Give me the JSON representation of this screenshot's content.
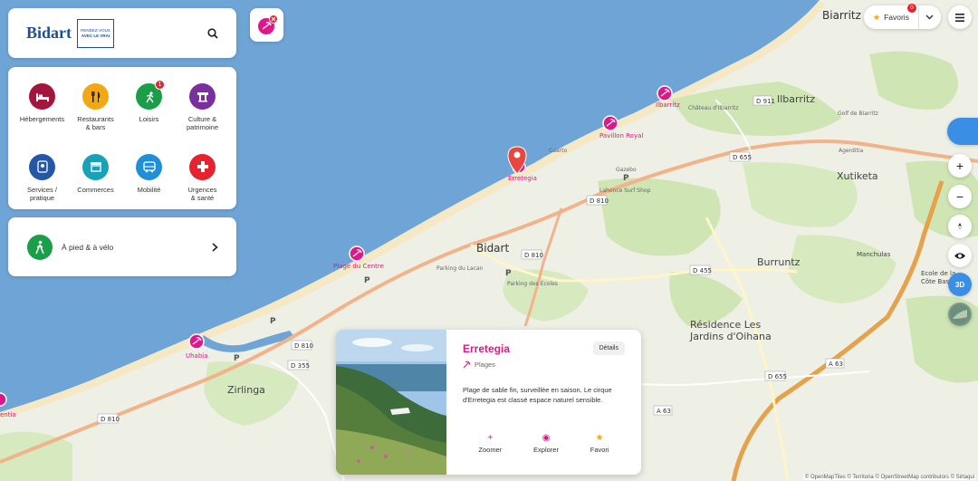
{
  "brand": {
    "name": "Bidart",
    "slogan_line1": "RENDEZ-VOUS",
    "slogan_line2": "AVEC LE VRAI"
  },
  "categories": [
    {
      "label": "Hébergements",
      "color": "#a3173f",
      "icon": "bed-icon"
    },
    {
      "label": "Restaurants\n& bars",
      "color": "#f3a712",
      "icon": "restaurant-icon"
    },
    {
      "label": "Loisirs",
      "color": "#1a9e47",
      "icon": "activity-icon",
      "badge": "1"
    },
    {
      "label": "Culture &\npatrimoine",
      "color": "#7b2f9e",
      "icon": "monument-icon"
    },
    {
      "label": "Services /\npratique",
      "color": "#2458a6",
      "icon": "info-icon"
    },
    {
      "label": "Commerces",
      "color": "#17a2b8",
      "icon": "shop-icon"
    },
    {
      "label": "Mobilité",
      "color": "#1f8fd6",
      "icon": "bus-icon"
    },
    {
      "label": "Urgences\n& santé",
      "color": "#e4232e",
      "icon": "cross-icon"
    }
  ],
  "walk": {
    "label": "À pied & à vélo"
  },
  "favorites": {
    "label": "Favoris",
    "count": "0"
  },
  "map_controls": {
    "three_d": "3D"
  },
  "map_labels": {
    "biarritz": "Biarritz",
    "ilbarritz": "Ilbarritz",
    "bidart": "Bidart",
    "burruntz": "Burruntz",
    "xutiketa": "Xutiketa",
    "zirlinga": "Zirlinga",
    "residence_line1": "Résidence Les",
    "residence_line2": "Jardins d'Oihana",
    "manchulas": "Manchulas",
    "ecole_line1": "Ecole de la",
    "ecole_line2": "Côte Basq",
    "chateau": "Château d'Ilbarritz",
    "parking_lacan": "Parking du Lacan",
    "parking_ecoles": "Parking des Ecoles",
    "golf": "Golf de Biarritz",
    "gazebo": "Gazebo",
    "surf_shop": "Lahonce Surf Shop",
    "agerditia": "Agerditia",
    "beach_erretegia": "Erretegia",
    "beach_centre": "Plage du Centre",
    "beach_uhabia": "Uhabia",
    "beach_ilbarritz": "Ilbarritz",
    "beach_pavillon": "Pavillon Royal",
    "beach_cuarto": "Cuarto",
    "beach_ententia": "entia"
  },
  "roads": [
    "D 810",
    "D 810",
    "D 810",
    "D 810",
    "D 655",
    "D 655",
    "D 455",
    "D 355",
    "D 911",
    "A 63",
    "A 63"
  ],
  "card": {
    "title": "Erretegia",
    "details_label": "Détails",
    "category": "Plages",
    "description": "Plage de sable fin, surveillée en saison. Le cirque d'Erretegia est classé espace naturel sensible.",
    "actions": {
      "zoom": "Zoomer",
      "explore": "Explorer",
      "favorite": "Favori"
    }
  },
  "attribution": "© OpenMapTiles © Territoria © OpenStreetMap contributors © Sirtaqui",
  "colors": {
    "sea": "#6ea4d6",
    "land": "#eef0e6",
    "green": "#cfe5b4",
    "beach": "#e0178a",
    "accent": "#3a8ee6"
  }
}
